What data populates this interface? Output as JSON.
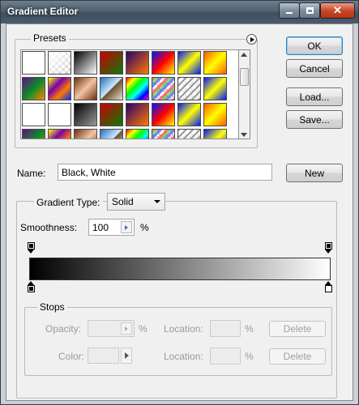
{
  "window": {
    "title": "Gradient Editor",
    "controls": [
      "minimize-icon",
      "maximize-icon",
      "close-icon"
    ]
  },
  "presets": {
    "label": "Presets",
    "menu_icon": "play-circle-icon",
    "swatches": [
      {
        "name": "foreground-to-background",
        "css": "linear-gradient(135deg,#fff 0%,#fff 100%)"
      },
      {
        "name": "foreground-to-transparent",
        "css": "checker-fade"
      },
      {
        "name": "black-white",
        "css": "linear-gradient(135deg,#000 0%,#fff 100%)"
      },
      {
        "name": "red-green",
        "css": "linear-gradient(135deg,#c00 0%,#0a7a0a 100%)"
      },
      {
        "name": "violet-orange",
        "css": "linear-gradient(135deg,#2b006b 0%,#ff7a00 100%)"
      },
      {
        "name": "blue-red-yellow",
        "css": "linear-gradient(135deg,#0018ff 0%,#f00 50%,#ff0 100%)"
      },
      {
        "name": "blue-yellow-blue",
        "css": "linear-gradient(135deg,#0018ff 0%,#ff0 50%,#0018ff 100%)"
      },
      {
        "name": "orange-yellow-orange",
        "css": "linear-gradient(135deg,#ff5a00 0%,#ff0 50%,#ff5a00 100%)"
      },
      {
        "name": "violet-green-orange",
        "css": "linear-gradient(135deg,#6b0a8a 0%,#0a8a2a 50%,#ff8a00 100%)"
      },
      {
        "name": "yellow-violet-orange-blue",
        "css": "linear-gradient(135deg,#ff0 0%,#7a00aa 35%,#ff7a00 65%,#0030ff 100%)"
      },
      {
        "name": "copper",
        "css": "linear-gradient(135deg,#6b2f14 0%,#f3c3a0 50%,#6b2f14 100%)"
      },
      {
        "name": "chrome",
        "css": "linear-gradient(135deg,#1e6fbd 0%,#cfe7ff 48%,#6b5230 52%,#e9e0cf 100%)"
      },
      {
        "name": "spectrum",
        "css": "linear-gradient(135deg,#f00 0%,#ff0 20%,#0f0 40%,#0ff 60%,#00f 80%,#f0f 100%)"
      },
      {
        "name": "transparent-rainbow",
        "css": "checker-rainbow"
      },
      {
        "name": "transparent-stripes",
        "css": "checker-stripes"
      },
      {
        "name": "blue-yellow-diag",
        "css": "linear-gradient(135deg,#0018ff 0%,#ff0 50%,#0018ff 100%)"
      },
      {
        "name": "black-white-2",
        "css": "linear-gradient(135deg,#fff 0%,#fff 100%)"
      },
      {
        "name": "white-black",
        "css": "linear-gradient(135deg,#fff 0%,#fff 100%)"
      },
      {
        "name": "dark-gray",
        "css": "linear-gradient(135deg,#000 0%,#999 100%)"
      },
      {
        "name": "red-green-2",
        "css": "linear-gradient(135deg,#c00 0%,#0a7a0a 100%)"
      },
      {
        "name": "violet-orange-2",
        "css": "linear-gradient(135deg,#2b006b 0%,#ff7a00 100%)"
      },
      {
        "name": "blue-red-yellow-2",
        "css": "linear-gradient(135deg,#0018ff 0%,#f00 50%,#ff0 100%)"
      },
      {
        "name": "blue-yellow-blue-2",
        "css": "linear-gradient(135deg,#0018ff 0%,#ff0 50%,#0018ff 100%)"
      },
      {
        "name": "orange-yellow-orange-2",
        "css": "linear-gradient(135deg,#ff5a00 0%,#ff0 50%,#ff5a00 100%)"
      },
      {
        "name": "partial-1",
        "css": "linear-gradient(135deg,#6b0a8a 0%,#0a8a2a 50%,#ff8a00 100%)"
      },
      {
        "name": "partial-2",
        "css": "linear-gradient(135deg,#ff0 0%,#7a00aa 35%,#ff7a00 65%,#0030ff 100%)"
      },
      {
        "name": "partial-3",
        "css": "linear-gradient(135deg,#6b2f14 0%,#f3c3a0 50%,#6b2f14 100%)"
      },
      {
        "name": "partial-4",
        "css": "linear-gradient(135deg,#1e6fbd 0%,#cfe7ff 48%,#6b5230 52%,#e9e0cf 100%)"
      },
      {
        "name": "partial-5",
        "css": "linear-gradient(135deg,#f00 0%,#ff0 20%,#0f0 40%,#0ff 60%,#00f 80%,#f0f 100%)"
      },
      {
        "name": "partial-6",
        "css": "checker-rainbow"
      },
      {
        "name": "partial-7",
        "css": "checker-stripes"
      },
      {
        "name": "partial-8",
        "css": "linear-gradient(135deg,#0018ff 0%,#ff0 50%,#0018ff 100%)"
      }
    ]
  },
  "name": {
    "label": "Name:",
    "value": "Black, White",
    "new_button": "New"
  },
  "gradient": {
    "type_label": "Gradient Type:",
    "type_value": "Solid",
    "smoothness_label": "Smoothness:",
    "smoothness_value": "100",
    "percent": "%"
  },
  "buttons": {
    "ok": "OK",
    "cancel": "Cancel",
    "load": "Load...",
    "save": "Save..."
  },
  "stops": {
    "label": "Stops",
    "opacity_label": "Opacity:",
    "color_label": "Color:",
    "location_label": "Location:",
    "percent": "%",
    "delete_label": "Delete"
  },
  "colors": {
    "window_bg": "#f0f0f0",
    "ok_border": "#3c7fb1",
    "gradient_start": "#000000",
    "gradient_end": "#ffffff"
  }
}
